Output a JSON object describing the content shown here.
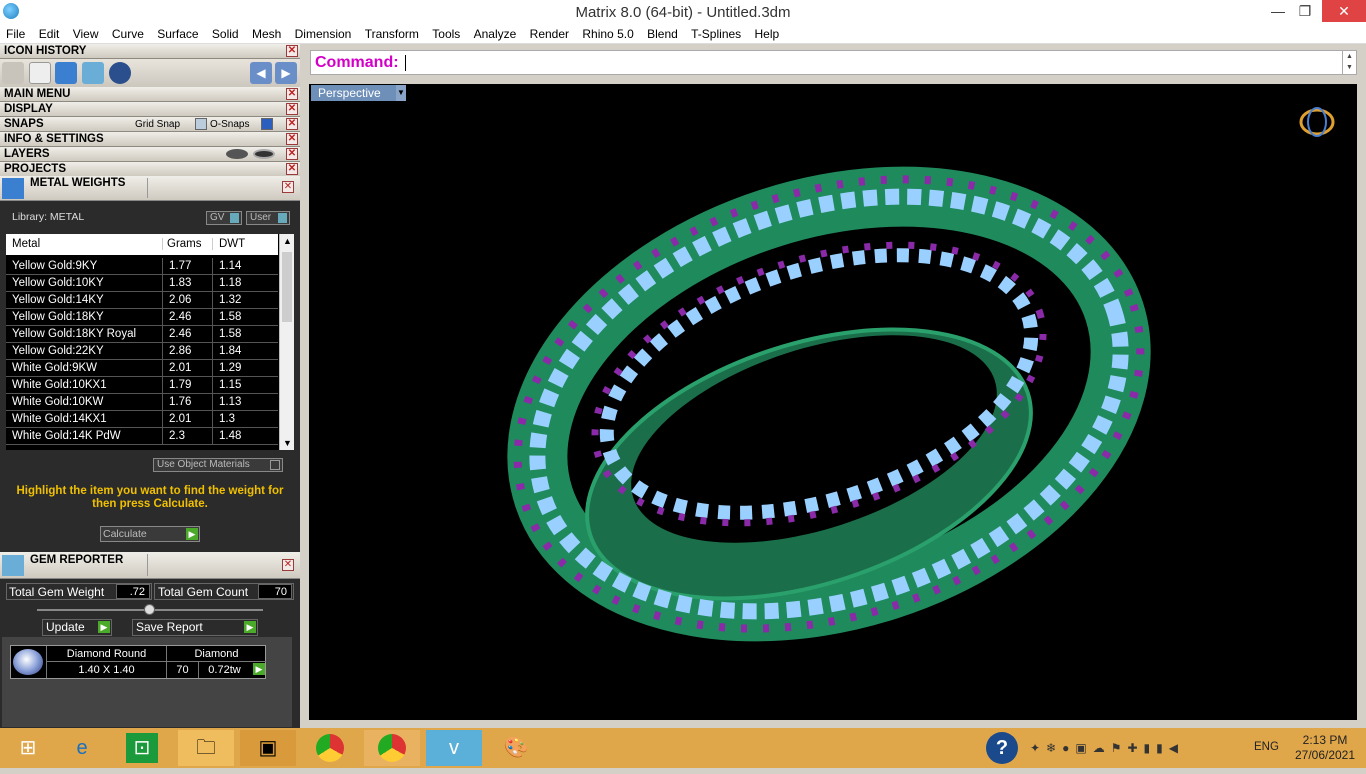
{
  "window": {
    "title": "Matrix 8.0 (64-bit) - Untitled.3dm",
    "minimize": "—",
    "restore": "❐",
    "close": "✕"
  },
  "menu": [
    "File",
    "Edit",
    "View",
    "Curve",
    "Surface",
    "Solid",
    "Mesh",
    "Dimension",
    "Transform",
    "Tools",
    "Analyze",
    "Render",
    "Rhino 5.0",
    "Blend",
    "T-Splines",
    "Help"
  ],
  "panels": {
    "icon_history": "ICON HISTORY",
    "main_menu": "MAIN MENU",
    "display": "DISPLAY",
    "snaps": "SNAPS",
    "grid_snap": "Grid Snap",
    "o_snaps": "O-Snaps",
    "info_settings": "INFO & SETTINGS",
    "layers": "LAYERS",
    "projects": "PROJECTS",
    "close_glyph": "✕"
  },
  "metal_weights": {
    "title": "METAL WEIGHTS",
    "library": "Library: METAL",
    "gv": "GV",
    "user": "User",
    "columns": [
      "Metal",
      "Grams",
      "DWT"
    ],
    "rows": [
      [
        "Yellow Gold:9KY",
        "1.77",
        "1.14"
      ],
      [
        "Yellow Gold:10KY",
        "1.83",
        "1.18"
      ],
      [
        "Yellow Gold:14KY",
        "2.06",
        "1.32"
      ],
      [
        "Yellow Gold:18KY",
        "2.46",
        "1.58"
      ],
      [
        "Yellow Gold:18KY Royal",
        "2.46",
        "1.58"
      ],
      [
        "Yellow Gold:22KY",
        "2.86",
        "1.84"
      ],
      [
        "White Gold:9KW",
        "2.01",
        "1.29"
      ],
      [
        "White Gold:10KX1",
        "1.79",
        "1.15"
      ],
      [
        "White Gold:10KW",
        "1.76",
        "1.13"
      ],
      [
        "White Gold:14KX1",
        "2.01",
        "1.3"
      ],
      [
        "White Gold:14K PdW",
        "2.3",
        "1.48"
      ]
    ],
    "use_object_materials": "Use Object Materials",
    "hint": "Highlight the item you want to find the weight for then press Calculate.",
    "calculate": "Calculate"
  },
  "gem_reporter": {
    "title": "GEM REPORTER",
    "total_weight_label": "Total Gem Weight",
    "total_weight": ".72",
    "total_count_label": "Total Gem Count",
    "total_count": "70",
    "update": "Update",
    "save_report": "Save Report",
    "gem_shape": "Diamond Round",
    "gem_size": "1.40 X 1.40",
    "gem_type": "Diamond",
    "gem_count": "70",
    "gem_weight": "0.72tw"
  },
  "command": {
    "label": "Command:"
  },
  "viewport": {
    "name": "Perspective"
  },
  "colors": {
    "metal": "#1f8a5c",
    "gem": "#9ad0ff",
    "prong": "#8a2aa8",
    "accent": "#d400c8"
  },
  "taskbar": {
    "lang": "ENG",
    "time": "2:13 PM",
    "date": "27/06/2021"
  }
}
